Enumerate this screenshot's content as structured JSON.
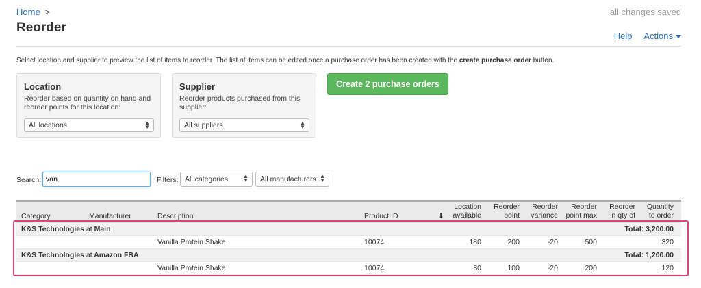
{
  "breadcrumb": {
    "home": "Home",
    "separator": ">"
  },
  "status": "all changes saved",
  "page_title": "Reorder",
  "links": {
    "help": "Help",
    "actions": "Actions"
  },
  "intro": {
    "before": "Select location and supplier to preview the list of items to reorder. The list of items can be edited once a purchase order has been created with the ",
    "bold": "create purchase order",
    "after": " button."
  },
  "location_panel": {
    "title": "Location",
    "description": "Reorder based on quantity on hand and reorder points for this location:",
    "selected": "All locations"
  },
  "supplier_panel": {
    "title": "Supplier",
    "description": "Reorder products purchased from this supplier:",
    "selected": "All suppliers"
  },
  "create_button": "Create 2 purchase orders",
  "search": {
    "label": "Search:",
    "value": "van"
  },
  "filters": {
    "label": "Filters:",
    "category": "All categories",
    "manufacturer": "All manufacturers"
  },
  "table": {
    "headers": {
      "category": "Category",
      "manufacturer": "Manufacturer",
      "description": "Description",
      "product_id": "Product ID",
      "location_available_1": "Location",
      "location_available_2": "available",
      "reorder_point_1": "Reorder",
      "reorder_point_2": "point",
      "reorder_variance_1": "Reorder",
      "reorder_variance_2": "variance",
      "reorder_point_max_1": "Reorder",
      "reorder_point_max_2": "point max",
      "reorder_qty_1": "Reorder",
      "reorder_qty_2": "in qty of",
      "quantity_1": "Quantity",
      "quantity_2": "to order"
    },
    "groups": [
      {
        "supplier": "K&S Technologies",
        "at": "at",
        "location": "Main",
        "total": "Total: 3,200.00",
        "row": {
          "description": "Vanilla Protein Shake",
          "product_id": "10074",
          "location_available": "180",
          "reorder_point": "200",
          "reorder_variance": "-20",
          "reorder_point_max": "500",
          "reorder_qty": "",
          "quantity": "320"
        }
      },
      {
        "supplier": "K&S Technologies",
        "at": "at",
        "location": "Amazon FBA",
        "total": "Total: 1,200.00",
        "row": {
          "description": "Vanilla Protein Shake",
          "product_id": "10074",
          "location_available": "80",
          "reorder_point": "100",
          "reorder_variance": "-20",
          "reorder_point_max": "200",
          "reorder_qty": "",
          "quantity": "120"
        }
      }
    ]
  },
  "colors": {
    "link": "#2a6ebb",
    "primary_button": "#5cb85c",
    "highlight": "#e0427c"
  }
}
